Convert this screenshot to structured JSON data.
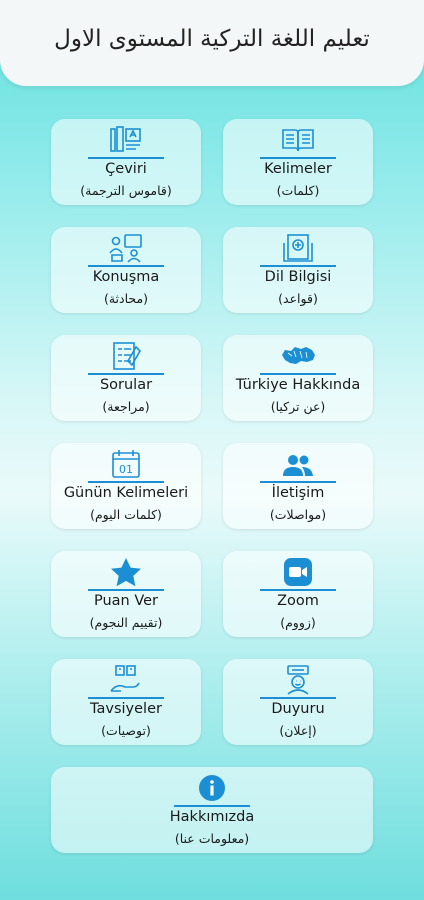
{
  "header": {
    "title": "تعليم اللغة التركية المستوى الاول"
  },
  "colors": {
    "icon": "#1c8fd4",
    "accent_line": "#1c8fd4"
  },
  "menu": {
    "ceviri": {
      "label": "Çeviri",
      "sub": "(قاموس الترجمة)",
      "icon": "translate-tools-icon"
    },
    "kelimeler": {
      "label": "Kelimeler",
      "sub": "(كلمات)",
      "icon": "open-book-icon"
    },
    "konusma": {
      "label": "Konuşma",
      "sub": "(محادثة)",
      "icon": "conversation-icon"
    },
    "dilbilgisi": {
      "label": "Dil Bilgisi",
      "sub": "(قواعد)",
      "icon": "grammar-book-icon"
    },
    "sorular": {
      "label": "Sorular",
      "sub": "(مراجعة)",
      "icon": "quiz-sheet-icon"
    },
    "turkiye": {
      "label": "Türkiye Hakkında",
      "sub": "(عن تركيا)",
      "icon": "turkey-map-icon"
    },
    "gunun": {
      "label": "Günün Kelimeleri",
      "sub": "(كلمات اليوم)",
      "icon": "calendar-icon",
      "calendar_day": "01"
    },
    "iletisim": {
      "label": "İletişim",
      "sub": "(مواصلات)",
      "icon": "people-icon"
    },
    "puan": {
      "label": "Puan Ver",
      "sub": "(تقييم النجوم)",
      "icon": "star-icon"
    },
    "zoom": {
      "label": "Zoom",
      "sub": "(زووم)",
      "icon": "video-camera-icon"
    },
    "tavsiye": {
      "label": "Tavsiyeler",
      "sub": "(توصيات)",
      "icon": "recommendation-hand-icon"
    },
    "duyuru": {
      "label": "Duyuru",
      "sub": "(إعلان)",
      "icon": "announcement-icon"
    },
    "hakkimizda": {
      "label": "Hakkımızda",
      "sub": "(معلومات عنا)",
      "icon": "info-icon"
    }
  }
}
